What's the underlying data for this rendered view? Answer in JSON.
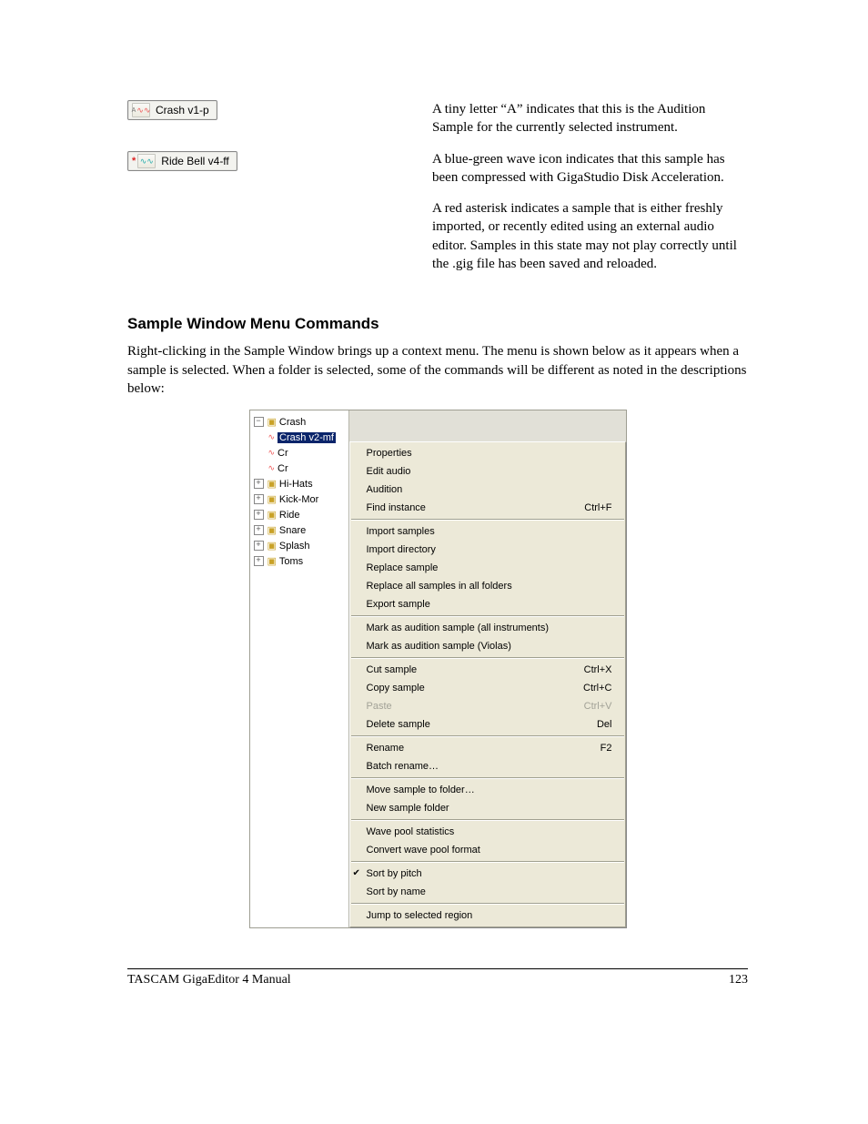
{
  "chips": {
    "crash": {
      "label": "Crash v1-p",
      "wave_class": "wave",
      "prefix": "A"
    },
    "ride": {
      "label": "Ride Bell v4-ff",
      "wave_class": "wave bg",
      "prefix": "*"
    }
  },
  "paragraphs": {
    "p1": "A tiny letter “A” indicates that this is the Audition Sample for the currently selected instrument.",
    "p2": "A blue-green wave icon indicates that this sample has been compressed with GigaStudio Disk Acceleration.",
    "p3": "A red asterisk indicates a sample that is either freshly imported, or recently edited using an external audio editor.  Samples in this state may not play correctly until the .gig file has been saved and reloaded."
  },
  "section_heading": "Sample Window Menu Commands",
  "section_body": "Right-clicking in the Sample Window brings up a context menu.  The menu is shown below as it appears when a sample is selected.  When a folder is selected, some of the commands will be different as noted in the descriptions below:",
  "tree": {
    "root": "Crash",
    "selected": "Crash v2-mf",
    "child_clip": "Cr",
    "folders": [
      "Hi-Hats",
      "Kick-Mor",
      "Ride",
      "Snare",
      "Splash",
      "Toms"
    ]
  },
  "menu": {
    "g1": [
      {
        "label": "Properties",
        "shortcut": ""
      },
      {
        "label": "Edit audio",
        "shortcut": ""
      },
      {
        "label": "Audition",
        "shortcut": ""
      },
      {
        "label": "Find instance",
        "shortcut": "Ctrl+F"
      }
    ],
    "g2": [
      {
        "label": "Import samples",
        "shortcut": ""
      },
      {
        "label": "Import directory",
        "shortcut": ""
      },
      {
        "label": "Replace sample",
        "shortcut": ""
      },
      {
        "label": "Replace all samples in all folders",
        "shortcut": ""
      },
      {
        "label": "Export sample",
        "shortcut": ""
      }
    ],
    "g3": [
      {
        "label": "Mark as audition sample (all instruments)",
        "shortcut": ""
      },
      {
        "label": "Mark as audition sample (Violas)",
        "shortcut": ""
      }
    ],
    "g4": [
      {
        "label": "Cut sample",
        "shortcut": "Ctrl+X",
        "disabled": false
      },
      {
        "label": "Copy sample",
        "shortcut": "Ctrl+C",
        "disabled": false
      },
      {
        "label": "Paste",
        "shortcut": "Ctrl+V",
        "disabled": true
      },
      {
        "label": "Delete sample",
        "shortcut": "Del",
        "disabled": false
      }
    ],
    "g5": [
      {
        "label": "Rename",
        "shortcut": "F2"
      },
      {
        "label": "Batch rename…",
        "shortcut": ""
      }
    ],
    "g6": [
      {
        "label": "Move sample to folder…",
        "shortcut": ""
      },
      {
        "label": "New sample folder",
        "shortcut": ""
      }
    ],
    "g7": [
      {
        "label": "Wave pool statistics",
        "shortcut": ""
      },
      {
        "label": "Convert wave pool format",
        "shortcut": ""
      }
    ],
    "g8": [
      {
        "label": "Sort by pitch",
        "shortcut": "",
        "checked": true
      },
      {
        "label": "Sort by name",
        "shortcut": ""
      }
    ],
    "g9": [
      {
        "label": "Jump to selected region",
        "shortcut": ""
      }
    ]
  },
  "footer": {
    "left": "TASCAM GigaEditor 4 Manual",
    "right": "123"
  }
}
